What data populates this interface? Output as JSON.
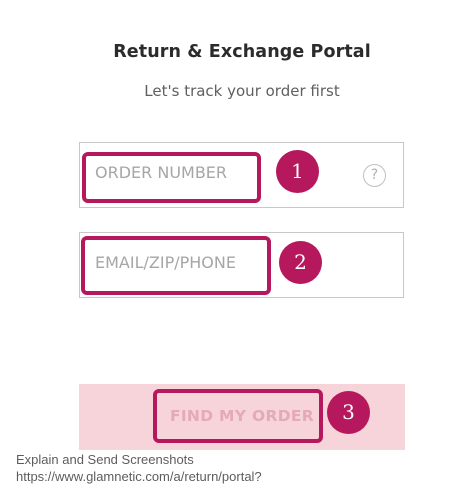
{
  "header": {
    "title": "Return & Exchange Portal",
    "subtitle": "Let's track your order first"
  },
  "form": {
    "order_number": {
      "placeholder": "ORDER NUMBER",
      "value": "",
      "help_icon": "question-circle-icon",
      "help_glyph": "?"
    },
    "contact": {
      "placeholder": "EMAIL/ZIP/PHONE",
      "value": ""
    },
    "submit_label": "FIND MY ORDER"
  },
  "annotations": [
    {
      "label": "1"
    },
    {
      "label": "2"
    },
    {
      "label": "3"
    }
  ],
  "footer": {
    "line1": "Explain and Send Screenshots",
    "line2": "https://www.glamnetic.com/a/return/portal?"
  },
  "colors": {
    "annotation": "#b5185c",
    "button_bg": "#f6d4d9",
    "button_text": "#e4aab6"
  }
}
